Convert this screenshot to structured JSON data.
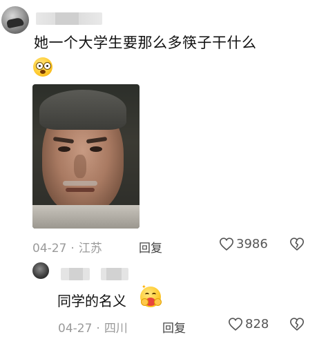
{
  "comment": {
    "text": "她一个大学生要那么多筷子干什么",
    "emoji": "flushed-face-emoji",
    "image": "man-portrait-photo",
    "date": "04-27",
    "separator": "·",
    "location": "江苏",
    "reply_label": "回复",
    "likes": "3986"
  },
  "reply": {
    "text": "同学的名义",
    "emoji": "hugging-face-emoji",
    "date": "04-27",
    "separator": "·",
    "location": "四川",
    "reply_label": "回复",
    "likes": "828"
  },
  "colors": {
    "meta_gray": "#9a9a9a",
    "text": "#111111",
    "icon_gray": "#555555"
  },
  "icons": [
    "heart-icon",
    "broken-heart-icon"
  ]
}
